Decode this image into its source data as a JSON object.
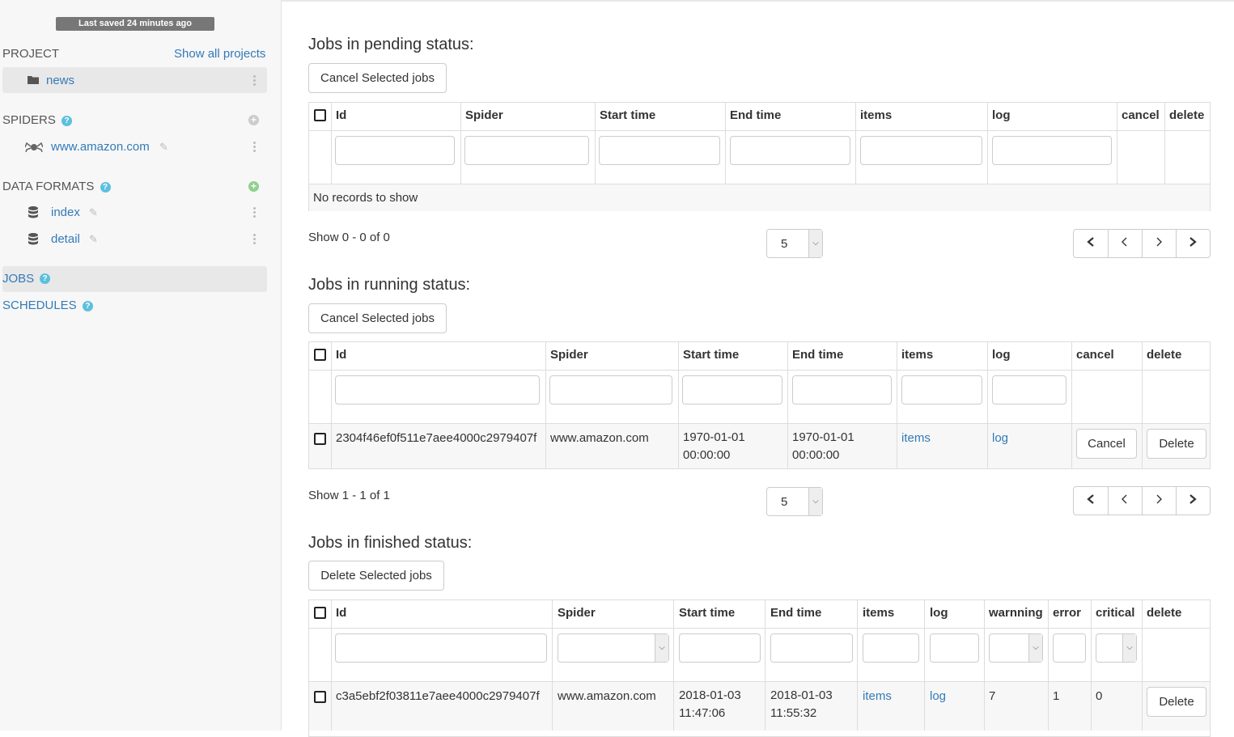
{
  "sidebar": {
    "saved_badge": "Last saved 24 minutes ago",
    "project_header": "PROJECT",
    "show_all_projects": "Show all projects",
    "project_name": "news",
    "spiders_header": "SPIDERS",
    "spider_name": "www.amazon.com",
    "data_formats_header": "DATA FORMATS",
    "data_formats": [
      "index",
      "detail"
    ],
    "jobs": "JOBS",
    "schedules": "SCHEDULES"
  },
  "pending": {
    "title": "Jobs in pending status:",
    "cancel_selected": "Cancel Selected jobs",
    "columns": [
      "Id",
      "Spider",
      "Start time",
      "End time",
      "items",
      "log",
      "cancel",
      "delete"
    ],
    "empty": "No records to show",
    "show_text": "Show 0 - 0 of 0",
    "page_size": "5"
  },
  "running": {
    "title": "Jobs in running status:",
    "cancel_selected": "Cancel Selected jobs",
    "columns": [
      "Id",
      "Spider",
      "Start time",
      "End time",
      "items",
      "log",
      "cancel",
      "delete"
    ],
    "row": {
      "id": "2304f46ef0f511e7aee4000c2979407f",
      "spider": "www.amazon.com",
      "start_date": "1970-01-01",
      "start_time": "00:00:00",
      "end_date": "1970-01-01",
      "end_time": "00:00:00",
      "items": "items",
      "log": "log",
      "cancel": "Cancel",
      "delete": "Delete"
    },
    "show_text": "Show 1 - 1 of 1",
    "page_size": "5"
  },
  "finished": {
    "title": "Jobs in finished status:",
    "delete_selected": "Delete Selected jobs",
    "columns": [
      "Id",
      "Spider",
      "Start time",
      "End time",
      "items",
      "log",
      "warnning",
      "error",
      "critical",
      "delete"
    ],
    "row": {
      "id": "c3a5ebf2f03811e7aee4000c2979407f",
      "spider": "www.amazon.com",
      "start_date": "2018-01-03",
      "start_time": "11:47:06",
      "end_date": "2018-01-03",
      "end_time": "11:55:32",
      "items": "items",
      "log": "log",
      "warnning": "7",
      "error": "1",
      "critical": "0",
      "delete": "Delete"
    }
  },
  "pager": {
    "first": "⏮",
    "prev": "‹",
    "next": "›",
    "last": "⏭"
  },
  "icons": {
    "folder": "folder-icon",
    "spider": "spider-icon",
    "database": "database-icon",
    "help": "question-circle-icon",
    "add": "plus-circle-icon",
    "edit": "pencil-icon"
  },
  "colors": {
    "link": "#337ab7",
    "help": "#5bc0de",
    "add_green": "#8fd18f",
    "add_grey": "#ccc",
    "badge": "#777"
  }
}
